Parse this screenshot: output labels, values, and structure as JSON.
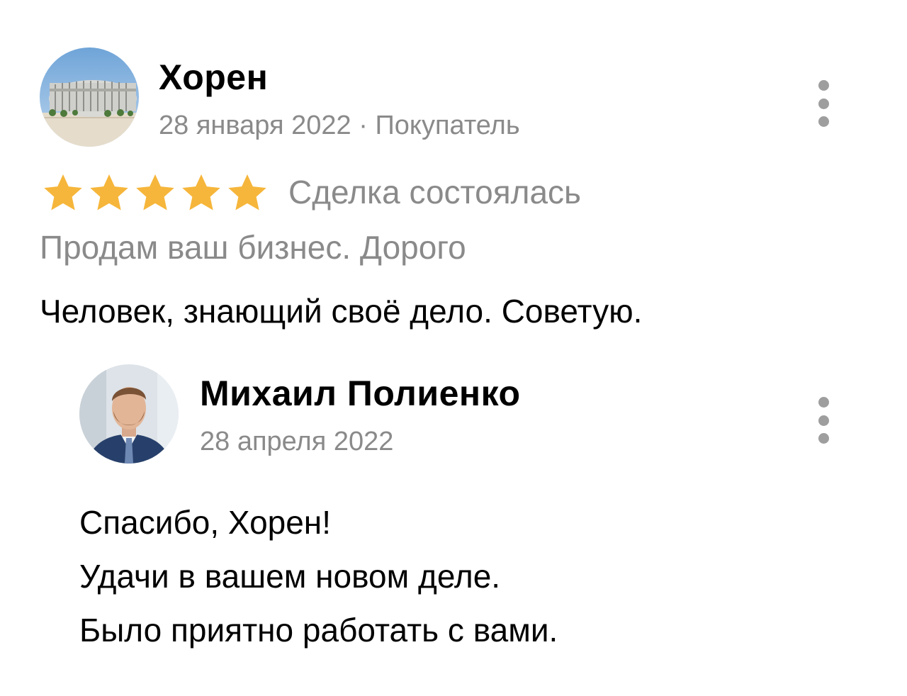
{
  "review": {
    "author": "Хорен",
    "date": "28 января 2022",
    "role": "Покупатель",
    "meta_separator": " · ",
    "rating": 5,
    "rating_max": 5,
    "star_color": "#F6B63B",
    "deal_status": "Сделка состоялась",
    "listing_title": "Продам ваш бизнес. Дорого",
    "text": "Человек, знающий своё дело. Советую.",
    "avatar_icon": "stadium-photo"
  },
  "reply": {
    "author": "Михаил Полиенко",
    "date": "28 апреля 2022",
    "avatar_icon": "portrait-photo",
    "lines": [
      "Спасибо, Хорен!",
      "Удачи в вашем новом деле.",
      "Было приятно работать с вами."
    ]
  },
  "menu_icon": "more-vertical-icon"
}
